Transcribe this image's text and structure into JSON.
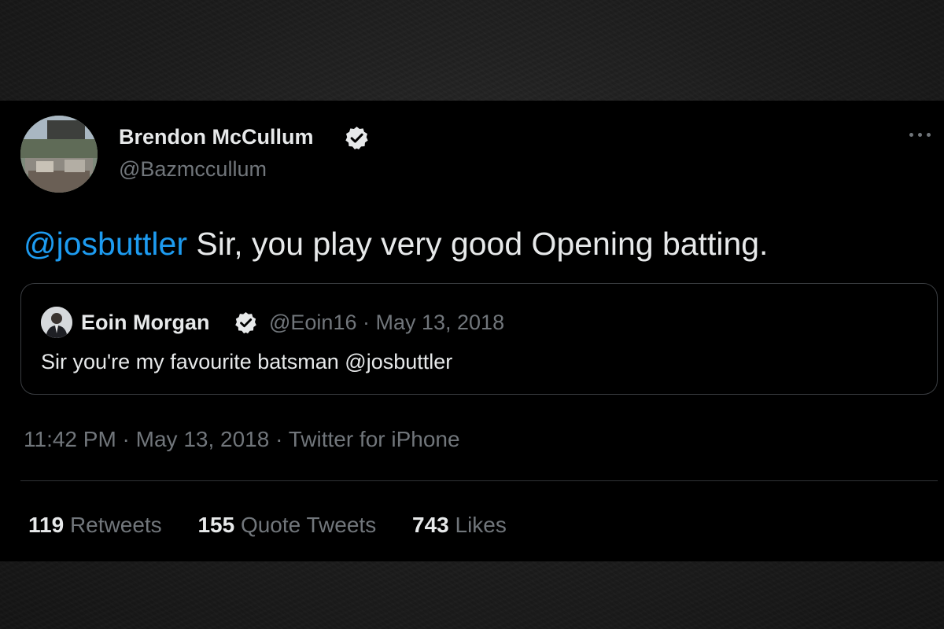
{
  "tweet": {
    "author": {
      "display_name": "Brendon McCullum",
      "handle": "@Bazmccullum",
      "verified": true,
      "avatar_icon": "profile-photo"
    },
    "text": {
      "mention": "@josbuttler",
      "body": " Sir, you play very good Opening batting."
    },
    "quoted_tweet": {
      "author_name": "Eoin Morgan",
      "verified": true,
      "meta": "@Eoin16 · May 13, 2018",
      "text": "Sir you're my favourite batsman @josbuttler"
    },
    "timestamp": "11:42 PM · May 13, 2018 · Twitter for iPhone",
    "stats": [
      {
        "count": "119",
        "label": "Retweets"
      },
      {
        "count": "155",
        "label": "Quote Tweets"
      },
      {
        "count": "743",
        "label": "Likes"
      }
    ]
  },
  "colors": {
    "card_background": "#000000",
    "primary_text": "#e7e9ea",
    "secondary_text": "#71767b",
    "link": "#1d9bf0",
    "page_background": "#1f1f1f"
  }
}
